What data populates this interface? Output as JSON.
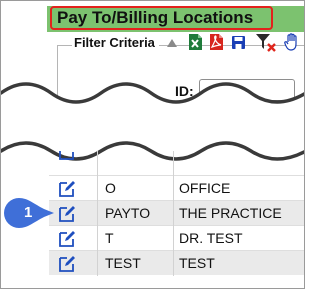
{
  "header": {
    "title": "Pay To/Billing Locations"
  },
  "filter": {
    "legend": "Filter Criteria",
    "id_label": "ID:",
    "toolbar_icons": [
      "collapse-icon",
      "excel-export-icon",
      "pdf-export-icon",
      "save-icon",
      "clear-filter-icon",
      "hand-icon"
    ]
  },
  "grid": {
    "rows": [
      {
        "code": "O",
        "name": "OFFICE"
      },
      {
        "code": "PAYTO",
        "name": "THE PRACTICE"
      },
      {
        "code": "T",
        "name": "DR. TEST"
      },
      {
        "code": "TEST",
        "name": "TEST"
      }
    ]
  },
  "callout": {
    "number": "1"
  },
  "colors": {
    "header_bar": "#7cc26f",
    "highlight_border": "#e3221c",
    "callout": "#3f6fd8",
    "edit_icon": "#1f4fbf"
  }
}
